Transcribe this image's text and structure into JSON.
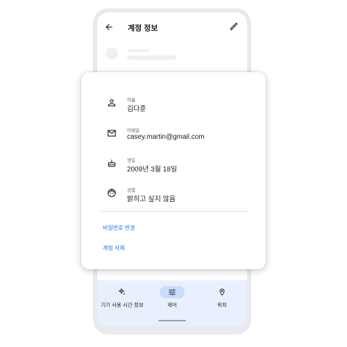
{
  "appbar": {
    "title": "계정 정보"
  },
  "fields": [
    {
      "label": "이름",
      "value": "김다훈",
      "icon": "person-icon"
    },
    {
      "label": "이메일",
      "value": "casey.martin@gmail.com",
      "icon": "mail-icon"
    },
    {
      "label": "생일",
      "value": "2009년 3월 18일",
      "icon": "cake-icon"
    },
    {
      "label": "성별",
      "value": "밝히고 싶지 않음",
      "icon": "face-icon"
    }
  ],
  "actions": {
    "change_password": "비밀번호 변경",
    "delete_account": "계정 삭제"
  },
  "bottom_nav": [
    {
      "label": "기기 사용 시간 정보",
      "icon": "sparkle-icon",
      "active": false
    },
    {
      "label": "제어",
      "icon": "tune-icon",
      "active": true
    },
    {
      "label": "위치",
      "icon": "location-pin-icon",
      "active": false
    }
  ],
  "colors": {
    "accent": "#1a73e8",
    "nav_bg": "#e8f0fe",
    "nav_active": "#c9dcfc"
  }
}
